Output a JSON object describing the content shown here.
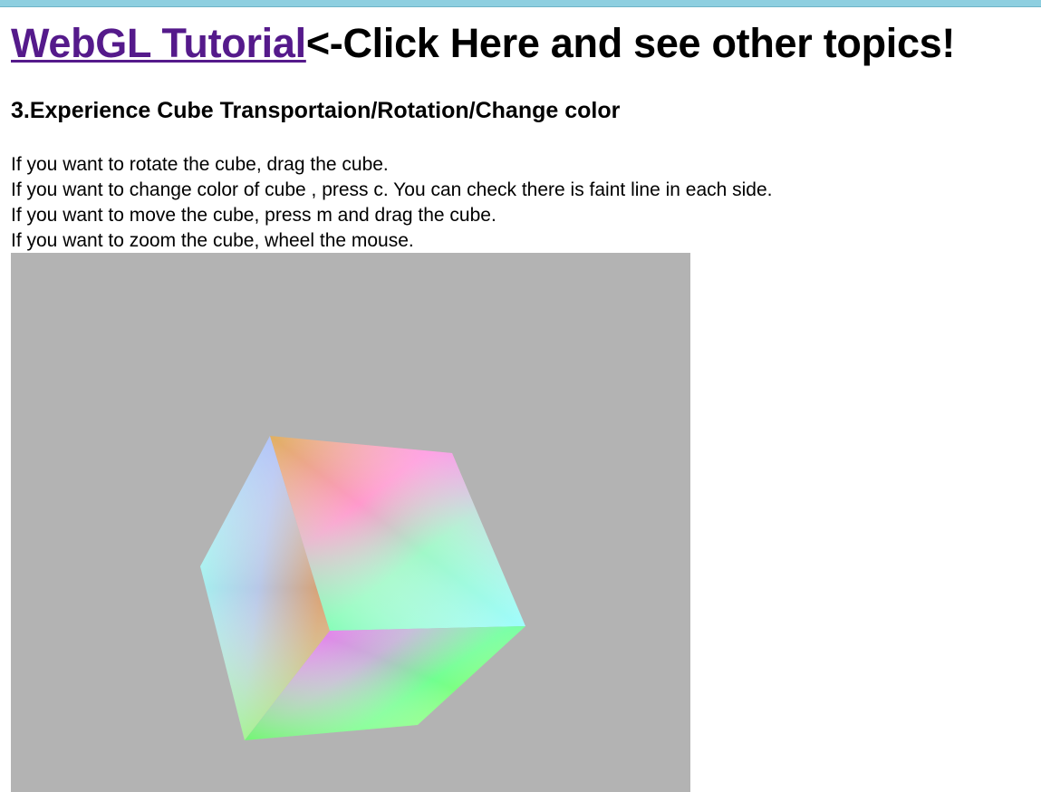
{
  "header": {
    "link_text": "WebGL Tutorial",
    "suffix_text": "<-Click Here and see other topics!"
  },
  "section": {
    "title": "3.Experience Cube Transportaion/Rotation/Change color"
  },
  "instructions": [
    "If you want to rotate the cube, drag the cube.",
    "If you want to change color of cube , press c. You can check there is faint line in each side.",
    "If you want to move the cube, press m and drag the cube.",
    "If you want to zoom the cube, wheel the mouse."
  ],
  "colors": {
    "link": "#551a8b",
    "canvas_background": "#b3b3b3",
    "top_strip": "#8ecfe0"
  }
}
